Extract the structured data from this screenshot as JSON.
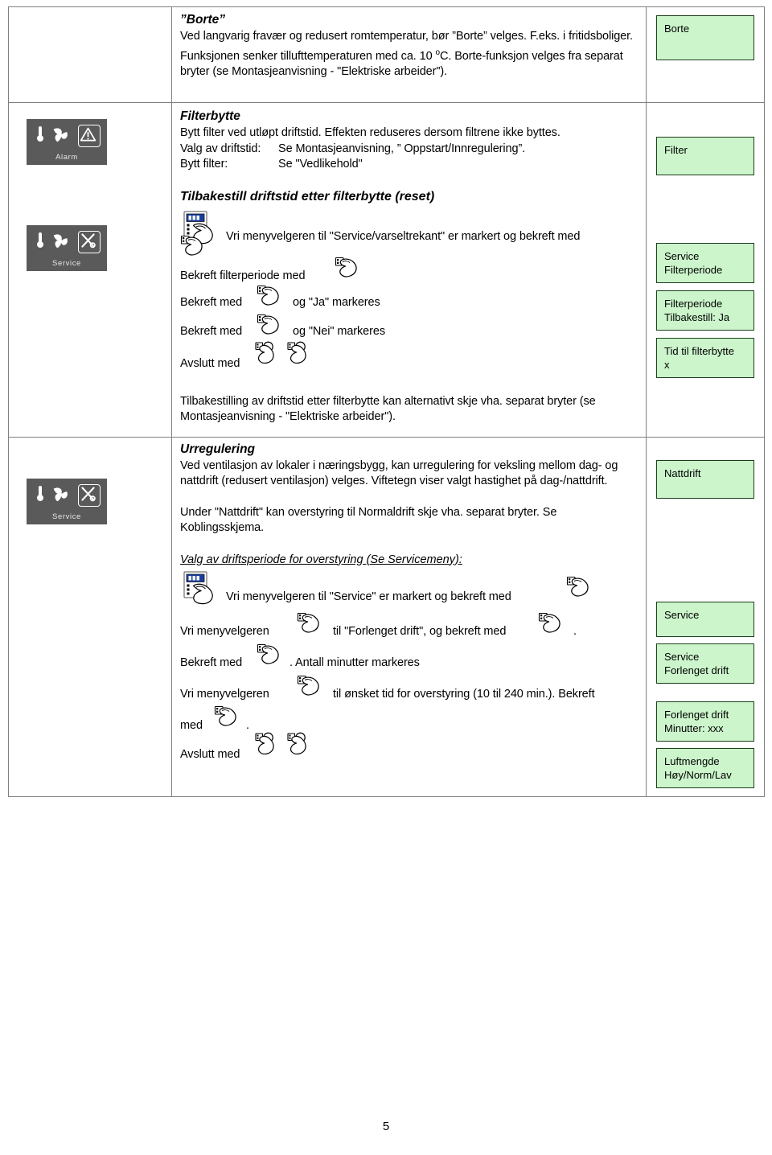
{
  "page": {
    "number": "5"
  },
  "colors": {
    "display_green": "#ccf5cc",
    "display_border": "#1c3d1c",
    "lcd_panel": "#5a5a5a",
    "table_border": "#808080"
  },
  "rows": {
    "borte": {
      "icon_panel": null,
      "heading": "”Borte”",
      "paragraph_1": "Ved langvarig fravær og redusert romtemperatur, bør ”Borte” velges. F.eks. i fritidsboliger. Funksjonen senker tillufttemperaturen med ca. 10 ",
      "paragraph_1_sup": "o",
      "paragraph_1_cont": "C. Borte-funksjon velges fra separat bryter (se Montasjeanvisning - \"Elektriske arbeider\").",
      "display_box": "Borte"
    },
    "filterbytte": {
      "icon_panel": {
        "label": "Alarm",
        "icons": [
          "thermometer-icon",
          "fan-icon",
          "warning-triangle-icon"
        ]
      },
      "heading": "Filterbytte",
      "line_1": "Bytt filter ved utløpt driftstid. Effekten reduseres dersom filtrene ikke byttes.",
      "line_2_label": "Valg av driftstid:",
      "line_2_value": "Se Montasjeanvisning, ” Oppstart/Innregulering”.",
      "line_3_label": "Bytt filter:",
      "line_3_value": "Se \"Vedlikehold\"",
      "display_box": "Filter"
    },
    "reset": {
      "icon_panel": {
        "label": "Service",
        "icons": [
          "thermometer-icon",
          "fan-icon",
          "tools-icon"
        ]
      },
      "heading": "Tilbakestill driftstid etter filterbytte (reset)",
      "step_1": "Vri menyvelgeren til \"Service/varseltrekant\" er markert og bekreft med",
      "step_2": "Bekreft filterperiode med",
      "step_3_a": "Bekreft med",
      "step_3_b": "og \"Ja\" markeres",
      "step_4_a": "Bekreft med",
      "step_4_b": "og \"Nei\" markeres",
      "step_5": "Avslutt med",
      "closing_paragraph": "Tilbakestilling av driftstid etter filterbytte kan alternativt skje vha. separat bryter (se Montasjeanvisning - \"Elektriske arbeider\").",
      "display_boxes": [
        {
          "line_1": "Service",
          "line_2": "Filterperiode"
        },
        {
          "line_1": "Filterperiode",
          "line_2": "Tilbakestill: Ja"
        },
        {
          "line_1": "Tid til filterbytte",
          "line_2": "x"
        }
      ]
    },
    "urregulering": {
      "icon_panel": {
        "label": "Service",
        "icons": [
          "thermometer-icon",
          "fan-icon",
          "tools-icon"
        ]
      },
      "heading": "Urregulering",
      "paragraph_1": "Ved ventilasjon av lokaler i næringsbygg, kan urregulering for veksling mellom dag- og nattdrift (redusert ventilasjon) velges. Viftetegn viser valgt hastighet på dag-/nattdrift.",
      "paragraph_2": "Under \"Nattdrift\" kan overstyring til Normaldrift skje vha. separat bryter. Se Koblingsskjema.",
      "subheading": "Valg av driftsperiode for overstyring (Se Servicemeny):",
      "step_1": "Vri menyvelgeren til \"Service\" er markert og bekreft med",
      "step_2_a": "Vri menyvelgeren",
      "step_2_b": "til \"Forlenget drift\", og bekreft med",
      "step_2_c": ".",
      "step_3_a": "Bekreft med",
      "step_3_b": ". Antall minutter markeres",
      "step_4_a": "Vri menyvelgeren",
      "step_4_b": "til ønsket tid for overstyring (10 til 240 min.). Bekreft",
      "step_4_c": "med",
      "step_4_d": ".",
      "step_5": "Avslutt med",
      "display_boxes": [
        {
          "line_1": "Nattdrift",
          "line_2": ""
        },
        {
          "line_1": "Service",
          "line_2": ""
        },
        {
          "line_1": "Service",
          "line_2": "Forlenget drift"
        },
        {
          "line_1": "Forlenget drift",
          "line_2": "Minutter:  xxx"
        },
        {
          "line_1": "Luftmengde",
          "line_2": "Høy/Norm/Lav"
        }
      ]
    }
  }
}
